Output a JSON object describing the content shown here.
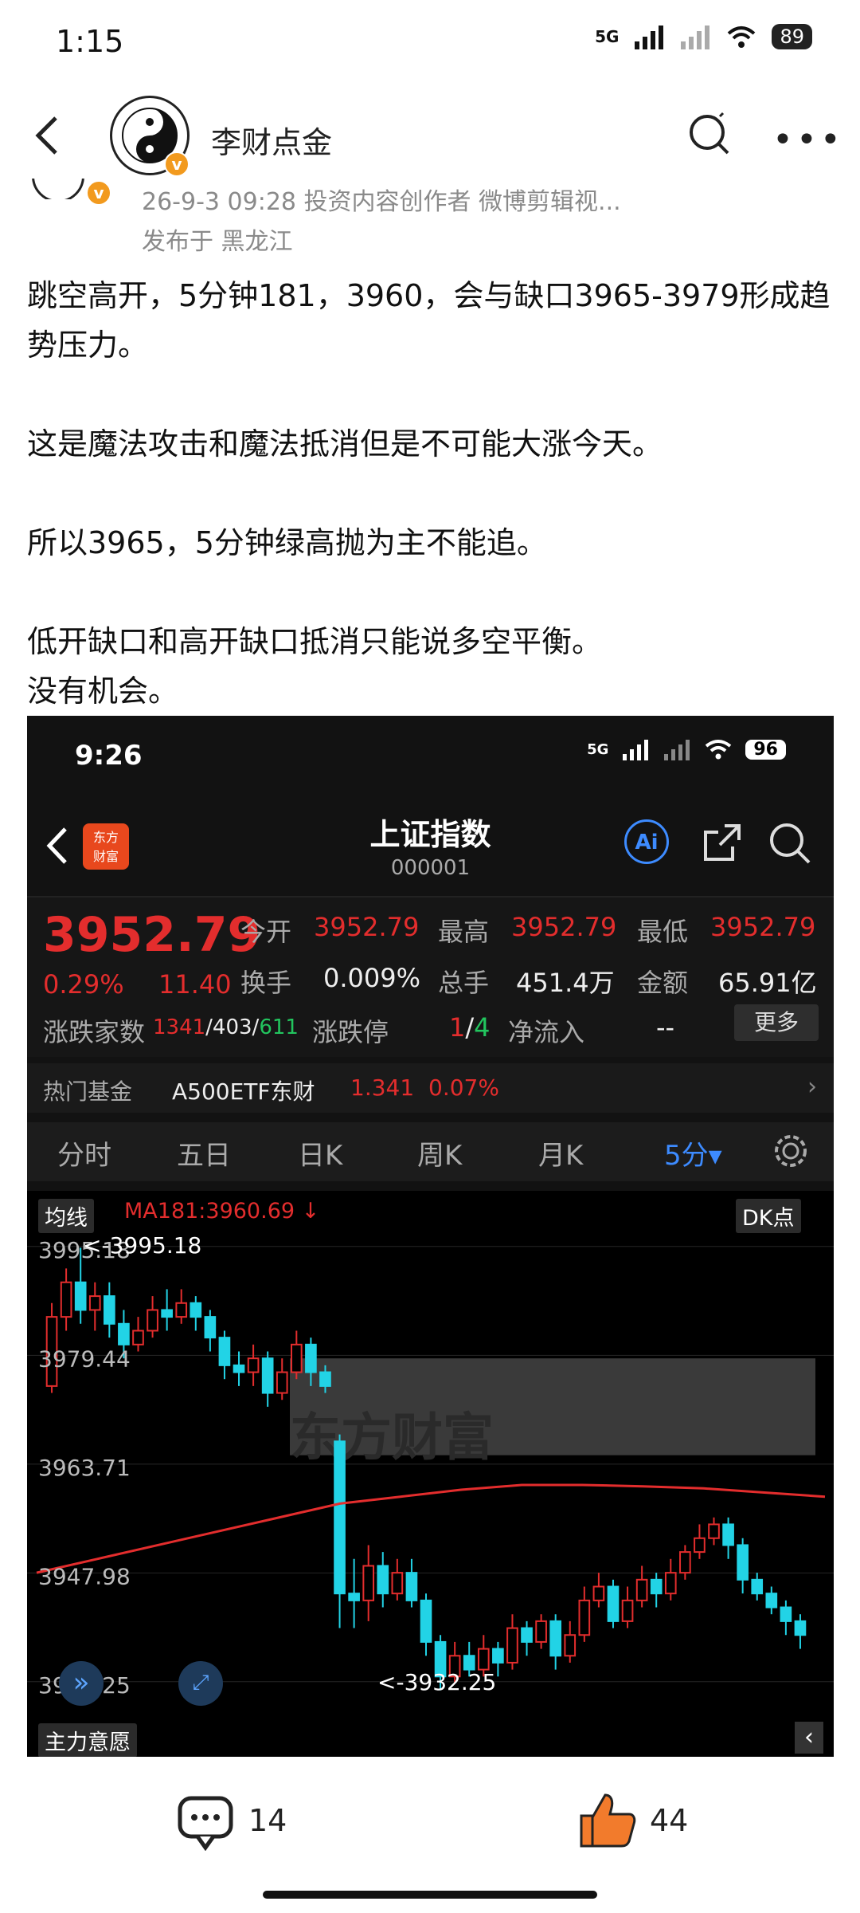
{
  "status_bar": {
    "time": "1:15",
    "network": "5G",
    "battery": "89"
  },
  "nav": {
    "author": "李财点金"
  },
  "meta": {
    "line1": "26-9-3 09:28  投资内容创作者 微博剪辑视...",
    "line2": "发布于 黑龙江"
  },
  "post": {
    "p1": "跳空高开，5分钟181，3960，会与缺口3965-3979形成趋势压力。",
    "p2": "这是魔法攻击和魔法抵消但是不可能大涨今天。",
    "p3": "所以3965，5分钟绿高抛为主不能追。",
    "p4": "低开缺口和高开缺口抵消只能说多空平衡。",
    "p5": "没有机会。"
  },
  "screenshot": {
    "time": "9:26",
    "network": "5G",
    "battery": "96",
    "brand": "东方财富",
    "title": "上证指数",
    "code": "000001",
    "ai_label": "Ai",
    "price": "3952.79",
    "pct": "0.29%",
    "change": "11.40",
    "open_label": "今开",
    "open": "3952.79",
    "high_label": "最高",
    "high": "3952.79",
    "low_label": "最低",
    "low": "3952.79",
    "turnover_label": "换手",
    "turnover": "0.009%",
    "volume_label": "总手",
    "volume": "451.4万",
    "amount_label": "金额",
    "amount": "65.91亿",
    "breadth_label": "涨跌家数",
    "breadth_up": "1341",
    "breadth_flat": "/403/",
    "breadth_down": "611",
    "limit_label": "涨跌停",
    "limit_up": "1",
    "limit_sep": "/",
    "limit_down": "4",
    "netflow_label": "净流入",
    "netflow": "--",
    "more": "更多",
    "fund_label": "热门基金",
    "fund_name": "A500ETF东财",
    "fund_price": "1.341",
    "fund_pct": "0.07%",
    "tabs": [
      "分时",
      "五日",
      "日K",
      "周K",
      "月K",
      "5分▾"
    ],
    "ma_select": "均线",
    "ma_text": "MA181:3960.69 ↓",
    "dk": "DK点",
    "bottom_select": "主力意愿",
    "watermark": "东方财富",
    "colors": {
      "up": "#e32d2d",
      "down": "#22d3e6",
      "accent": "#3d8bff"
    }
  },
  "chart_data": {
    "type": "candlestick",
    "y_ticks": [
      "3995.18",
      "3979.44",
      "3963.71",
      "3947.98",
      "3932.25"
    ],
    "ylim": [
      3929,
      3997
    ],
    "annotations": [
      "<-3995.18",
      "<-3932.25"
    ],
    "gap_zone": [
      3965,
      3979
    ],
    "candles": [
      [
        3975,
        3985,
        3974,
        3987
      ],
      [
        3985,
        3990,
        3983,
        3992
      ],
      [
        3990,
        3986,
        3984,
        3995
      ],
      [
        3986,
        3988,
        3983,
        3990
      ],
      [
        3988,
        3984,
        3982,
        3990
      ],
      [
        3984,
        3981,
        3979,
        3986
      ],
      [
        3981,
        3983,
        3980,
        3985
      ],
      [
        3983,
        3986,
        3982,
        3988
      ],
      [
        3986,
        3985,
        3983,
        3989
      ],
      [
        3985,
        3987,
        3984,
        3989
      ],
      [
        3987,
        3985,
        3983,
        3988
      ],
      [
        3985,
        3982,
        3980,
        3986
      ],
      [
        3982,
        3978,
        3976,
        3983
      ],
      [
        3978,
        3977,
        3975,
        3980
      ],
      [
        3977,
        3979,
        3975,
        3981
      ],
      [
        3979,
        3974,
        3972,
        3980
      ],
      [
        3974,
        3977,
        3973,
        3979
      ],
      [
        3977,
        3981,
        3976,
        3983
      ],
      [
        3981,
        3977,
        3975,
        3982
      ],
      [
        3977,
        3975,
        3974,
        3978
      ],
      [
        3967,
        3945,
        3940,
        3968
      ],
      [
        3945,
        3944,
        3940,
        3950
      ],
      [
        3944,
        3949,
        3941,
        3952
      ],
      [
        3949,
        3945,
        3943,
        3951
      ],
      [
        3945,
        3948,
        3944,
        3950
      ],
      [
        3948,
        3944,
        3943,
        3950
      ],
      [
        3944,
        3938,
        3936,
        3945
      ],
      [
        3938,
        3933,
        3931,
        3939
      ],
      [
        3933,
        3936,
        3932,
        3938
      ],
      [
        3936,
        3934,
        3933,
        3938
      ],
      [
        3934,
        3937,
        3933,
        3939
      ],
      [
        3937,
        3935,
        3933,
        3938
      ],
      [
        3935,
        3940,
        3934,
        3942
      ],
      [
        3940,
        3938,
        3936,
        3941
      ],
      [
        3938,
        3941,
        3937,
        3942
      ],
      [
        3941,
        3936,
        3934,
        3942
      ],
      [
        3936,
        3939,
        3935,
        3941
      ],
      [
        3939,
        3944,
        3938,
        3946
      ],
      [
        3944,
        3946,
        3943,
        3948
      ],
      [
        3946,
        3941,
        3940,
        3947
      ],
      [
        3941,
        3944,
        3940,
        3946
      ],
      [
        3944,
        3947,
        3943,
        3949
      ],
      [
        3947,
        3945,
        3943,
        3948
      ],
      [
        3945,
        3948,
        3944,
        3950
      ],
      [
        3948,
        3951,
        3947,
        3952
      ],
      [
        3951,
        3953,
        3950,
        3955
      ],
      [
        3953,
        3955,
        3952,
        3956
      ],
      [
        3955,
        3952,
        3950,
        3956
      ],
      [
        3952,
        3947,
        3945,
        3953
      ],
      [
        3947,
        3945,
        3944,
        3948
      ],
      [
        3945,
        3943,
        3942,
        3946
      ],
      [
        3943,
        3941,
        3939,
        3944
      ],
      [
        3941,
        3939,
        3937,
        3942
      ]
    ],
    "ma181": [
      3948,
      3950,
      3952,
      3954,
      3956,
      3958,
      3959,
      3960,
      3960.7,
      3960.7,
      3960.5,
      3960.2,
      3959.6,
      3959
    ],
    "colors": {
      "up": "#e32d2d",
      "down": "#22d3e6",
      "ma": "#e32d2d"
    }
  },
  "footer": {
    "comments": "14",
    "likes": "44"
  }
}
